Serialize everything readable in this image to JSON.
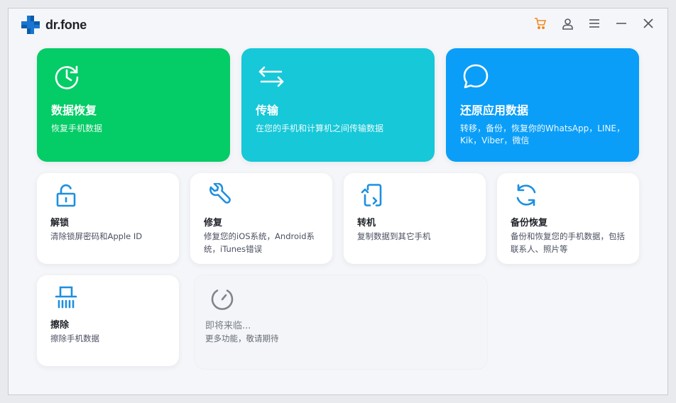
{
  "app": {
    "name": "dr.fone",
    "brand_color": "#1876d2"
  },
  "window_controls": [
    {
      "name": "cart-icon",
      "color": "#f08a1f"
    },
    {
      "name": "account-icon",
      "color": "#555a63"
    },
    {
      "name": "menu-icon",
      "color": "#555a63"
    },
    {
      "name": "minimize-icon",
      "color": "#555a63"
    },
    {
      "name": "close-icon",
      "color": "#555a63"
    }
  ],
  "features": {
    "recovery": {
      "title": "数据恢复",
      "desc": "恢复手机数据",
      "color": "#04cc66",
      "icon": "clock-restore-icon"
    },
    "transfer": {
      "title": "传输",
      "desc": "在您的手机和计算机之间传输数据",
      "color": "#16c8d8",
      "icon": "arrows-swap-icon"
    },
    "restore_app": {
      "title": "还原应用数据",
      "desc": "转移，备份，恢复你的WhatsApp，LINE，Kik，Viber，微信",
      "color": "#0a9ef8",
      "icon": "chat-bubble-icon"
    },
    "unlock": {
      "title": "解锁",
      "desc": "清除锁屏密码和Apple ID",
      "icon": "unlock-icon"
    },
    "repair": {
      "title": "修复",
      "desc": "修复您的iOS系统，Android系统，iTunes错误",
      "icon": "wrench-icon"
    },
    "phone_transfer": {
      "title": "转机",
      "desc": "复制数据到其它手机",
      "icon": "phone-transfer-icon"
    },
    "backup": {
      "title": "备份恢复",
      "desc": "备份和恢复您的手机数据，包括联系人、照片等",
      "icon": "sync-icon"
    },
    "erase": {
      "title": "擦除",
      "desc": "擦除手机数据",
      "icon": "shredder-icon"
    },
    "coming_soon": {
      "title": "即将来临...",
      "desc": "更多功能，敬请期待",
      "icon": "timer-icon"
    }
  },
  "icon_color": "#1d8fe0"
}
